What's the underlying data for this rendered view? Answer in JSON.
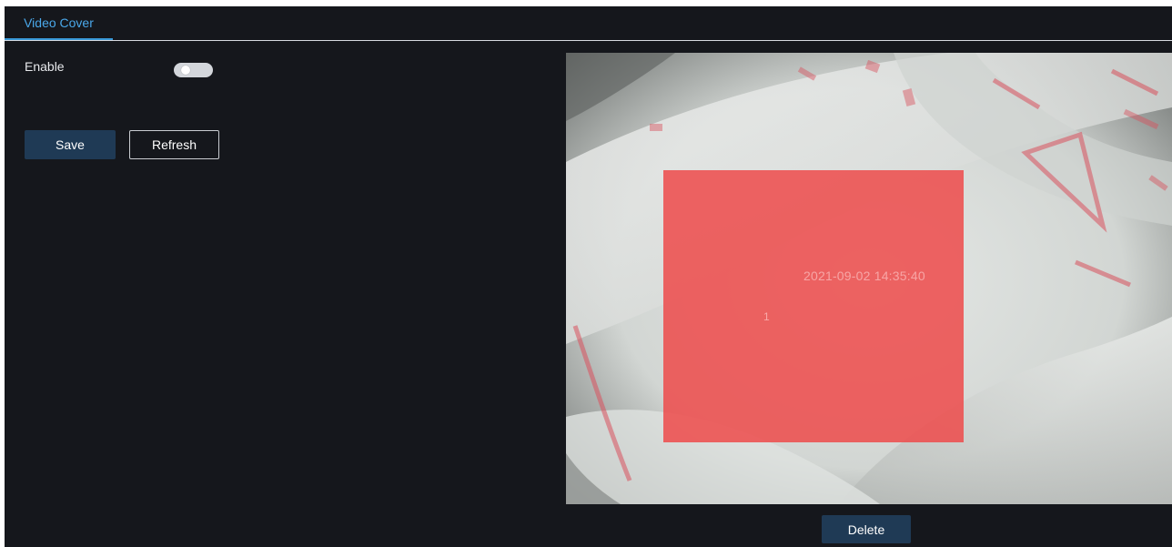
{
  "tabs": [
    {
      "label": "Video Cover",
      "active": true
    }
  ],
  "settings": {
    "enable_label": "Enable",
    "enabled": false
  },
  "actions": {
    "save_label": "Save",
    "refresh_label": "Refresh",
    "delete_label": "Delete"
  },
  "preview": {
    "osd_timestamp": "2021-09-02 14:35:40",
    "mask_regions": [
      {
        "index_label": "1",
        "color": "#ee4c4c"
      }
    ]
  },
  "colors": {
    "background": "#15171c",
    "accent": "#3a9ad9",
    "primary_button": "#1f3a55",
    "mask": "#ee4c4c"
  }
}
